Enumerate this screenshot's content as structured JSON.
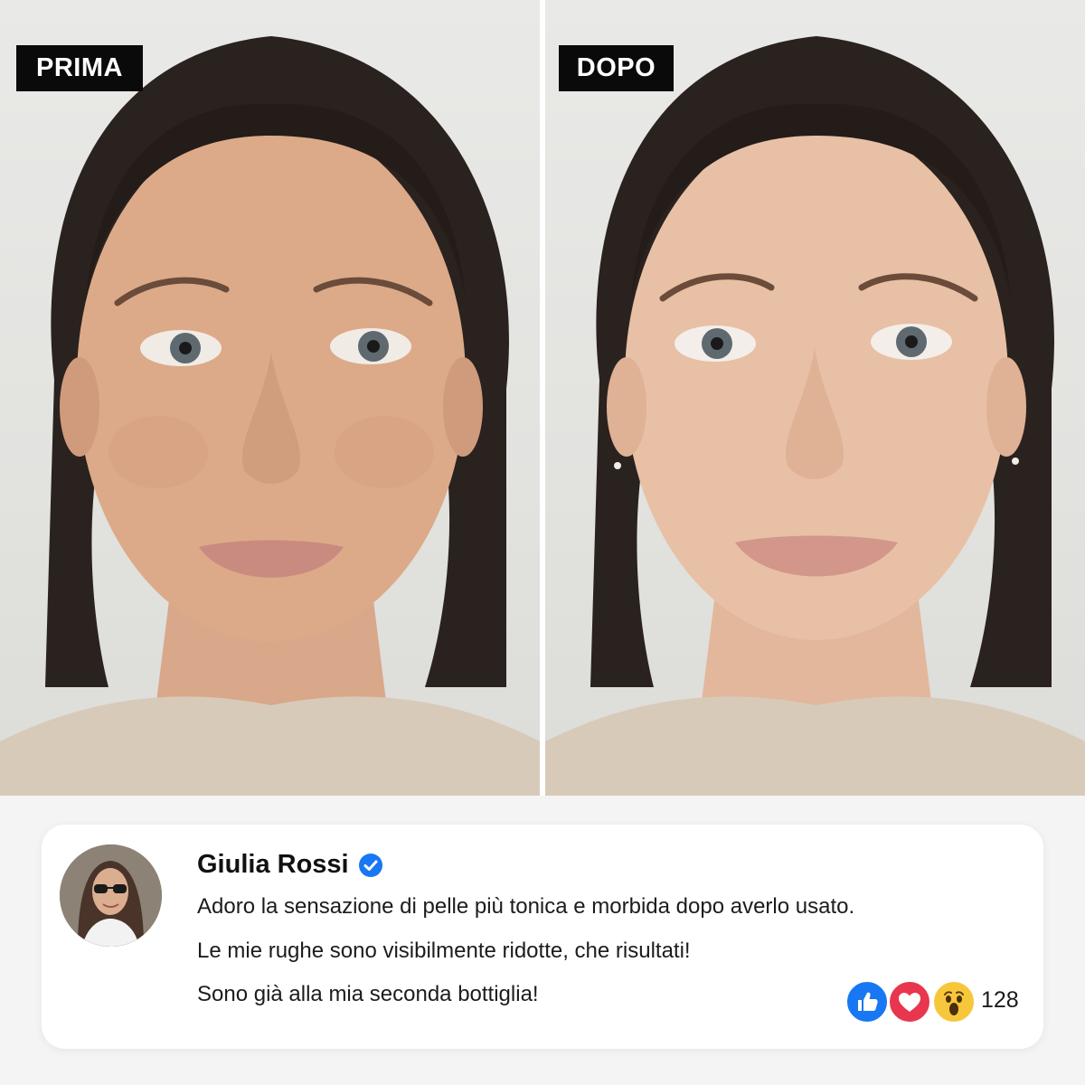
{
  "photos": {
    "before": {
      "label": "PRIMA"
    },
    "after": {
      "label": "DOPO"
    }
  },
  "review": {
    "user_name": "Giulia Rossi",
    "verified": true,
    "lines": [
      "Adoro la sensazione di pelle più tonica e morbida dopo averlo usato.",
      "Le mie rughe sono visibilmente ridotte, che risultati!",
      "Sono già alla mia seconda bottiglia!"
    ],
    "reactions": {
      "icons": [
        "like-icon",
        "love-icon",
        "wow-icon"
      ],
      "count": "128"
    }
  },
  "colors": {
    "badge_bg": "#0a0a0a",
    "verified_blue": "#1877f2",
    "love_red": "#e8364f",
    "wow_yellow": "#f7c73b"
  }
}
